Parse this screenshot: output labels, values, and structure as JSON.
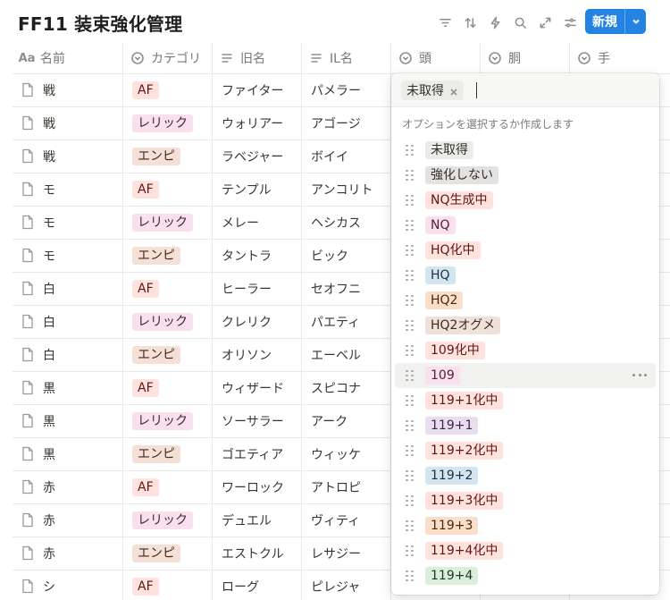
{
  "page": {
    "title": "FF11 装束強化管理"
  },
  "toolbar": {
    "icons": [
      "filter-icon",
      "sort-icon",
      "automation-icon",
      "search-icon",
      "expand-icon",
      "settings-icon"
    ],
    "new_label": "新規"
  },
  "colors": {
    "accent": "#2383e2",
    "af_bg": "#ffe2dd",
    "relic_bg": "#f9e0ec",
    "empy_bg": "#f4e0d6"
  },
  "table": {
    "columns": [
      {
        "label": "名前",
        "icon": "title-icon"
      },
      {
        "label": "カテゴリ",
        "icon": "select-icon"
      },
      {
        "label": "旧名",
        "icon": "text-icon"
      },
      {
        "label": "IL名",
        "icon": "text-icon"
      },
      {
        "label": "頭",
        "icon": "select-icon"
      },
      {
        "label": "胴",
        "icon": "select-icon"
      },
      {
        "label": "手",
        "icon": "select-icon"
      }
    ],
    "rows": [
      {
        "name": "戦",
        "cat": "AF",
        "cat_type": "af",
        "old": "ファイター",
        "il": "パメラー"
      },
      {
        "name": "戦",
        "cat": "レリック",
        "cat_type": "relic",
        "old": "ウォリアー",
        "il": "アゴージ"
      },
      {
        "name": "戦",
        "cat": "エンピ",
        "cat_type": "empy",
        "old": "ラベジャー",
        "il": "ボイイ"
      },
      {
        "name": "モ",
        "cat": "AF",
        "cat_type": "af",
        "old": "テンプル",
        "il": "アンコリト"
      },
      {
        "name": "モ",
        "cat": "レリック",
        "cat_type": "relic",
        "old": "メレー",
        "il": "ヘシカス"
      },
      {
        "name": "モ",
        "cat": "エンピ",
        "cat_type": "empy",
        "old": "タントラ",
        "il": "ビック"
      },
      {
        "name": "白",
        "cat": "AF",
        "cat_type": "af",
        "old": "ヒーラー",
        "il": "セオフニ"
      },
      {
        "name": "白",
        "cat": "レリック",
        "cat_type": "relic",
        "old": "クレリク",
        "il": "パエティ"
      },
      {
        "name": "白",
        "cat": "エンピ",
        "cat_type": "empy",
        "old": "オリソン",
        "il": "エーベル"
      },
      {
        "name": "黒",
        "cat": "AF",
        "cat_type": "af",
        "old": "ウィザード",
        "il": "スピコナ"
      },
      {
        "name": "黒",
        "cat": "レリック",
        "cat_type": "relic",
        "old": "ソーサラー",
        "il": "アーク"
      },
      {
        "name": "黒",
        "cat": "エンピ",
        "cat_type": "empy",
        "old": "ゴエティア",
        "il": "ウィッケ"
      },
      {
        "name": "赤",
        "cat": "AF",
        "cat_type": "af",
        "old": "ワーロック",
        "il": "アトロピ"
      },
      {
        "name": "赤",
        "cat": "レリック",
        "cat_type": "relic",
        "old": "デュエル",
        "il": "ヴィティ"
      },
      {
        "name": "赤",
        "cat": "エンピ",
        "cat_type": "empy",
        "old": "エストクル",
        "il": "レサジー"
      },
      {
        "name": "シ",
        "cat": "AF",
        "cat_type": "af",
        "old": "ローグ",
        "il": "ピレジャ"
      }
    ]
  },
  "dropdown": {
    "selected": "未取得",
    "hint": "オプションを選択するか作成します",
    "options": [
      {
        "label": "未取得",
        "bg": "#ececea",
        "fg": "#32302c"
      },
      {
        "label": "強化しない",
        "bg": "#e3e2e0",
        "fg": "#32302c"
      },
      {
        "label": "NQ生成中",
        "bg": "#ffe2dd",
        "fg": "#5d1715"
      },
      {
        "label": "NQ",
        "bg": "#f9e0ec",
        "fg": "#4c2337"
      },
      {
        "label": "HQ化中",
        "bg": "#ffe2dd",
        "fg": "#5d1715"
      },
      {
        "label": "HQ",
        "bg": "#d3e5ef",
        "fg": "#183347"
      },
      {
        "label": "HQ2",
        "bg": "#fadec9",
        "fg": "#49290e"
      },
      {
        "label": "HQ2オグメ",
        "bg": "#eee0da",
        "fg": "#44291c"
      },
      {
        "label": "109化中",
        "bg": "#ffe2dd",
        "fg": "#5d1715"
      },
      {
        "label": "109",
        "bg": "#f9e0ec",
        "fg": "#4c2337"
      },
      {
        "label": "119+1化中",
        "bg": "#ffe2dd",
        "fg": "#5d1715"
      },
      {
        "label": "119+1",
        "bg": "#e8deee",
        "fg": "#412454"
      },
      {
        "label": "119+2化中",
        "bg": "#ffe2dd",
        "fg": "#5d1715"
      },
      {
        "label": "119+2",
        "bg": "#d3e5ef",
        "fg": "#183347"
      },
      {
        "label": "119+3化中",
        "bg": "#ffe2dd",
        "fg": "#5d1715"
      },
      {
        "label": "119+3",
        "bg": "#fadec9",
        "fg": "#49290e"
      },
      {
        "label": "119+4化中",
        "bg": "#ffe2dd",
        "fg": "#5d1715"
      },
      {
        "label": "119+4",
        "bg": "#dbeddb",
        "fg": "#1c3829"
      }
    ],
    "hovered_option": "109"
  }
}
